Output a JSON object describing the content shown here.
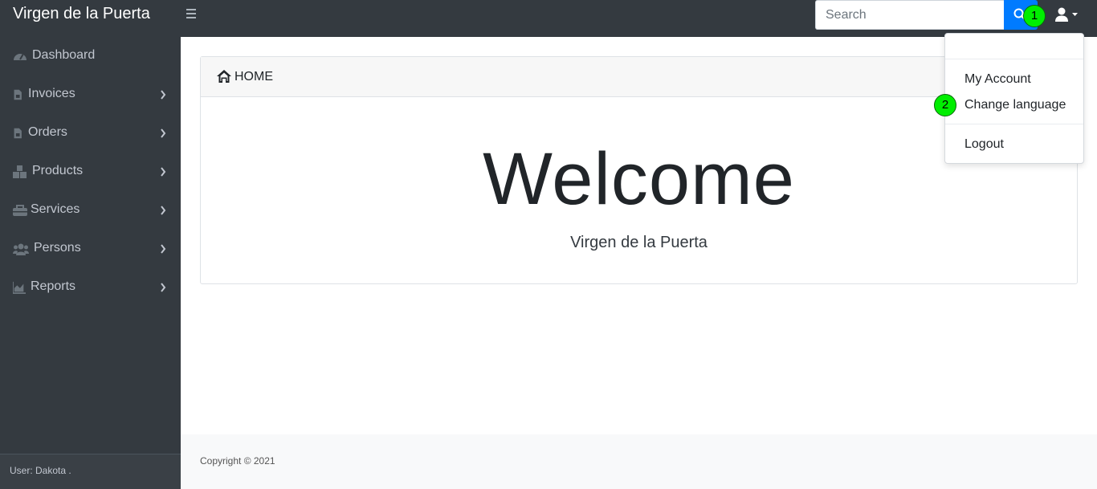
{
  "header": {
    "brand": "Virgen de la Puerta",
    "search_placeholder": "Search"
  },
  "sidebar": {
    "items": [
      {
        "label": "Dashboard",
        "icon": "dashboard-icon"
      },
      {
        "label": "Invoices",
        "icon": "file-invoice-icon"
      },
      {
        "label": "Orders",
        "icon": "file-invoice-icon"
      },
      {
        "label": "Products",
        "icon": "boxes-icon"
      },
      {
        "label": "Services",
        "icon": "toolbox-icon"
      },
      {
        "label": "Persons",
        "icon": "users-icon"
      },
      {
        "label": "Reports",
        "icon": "chart-area-icon"
      }
    ],
    "footer_user": "User: Dakota ."
  },
  "card": {
    "header_label": "HOME",
    "title": "Welcome",
    "subtitle": "Virgen de la Puerta"
  },
  "user_menu": {
    "items": [
      "My Account",
      "Change language",
      "Logout"
    ]
  },
  "markers": [
    "1",
    "2"
  ],
  "footer": {
    "copyright": "Copyright © 2021"
  },
  "colors": {
    "topbar": "#343a40",
    "sidebar": "#343a40",
    "primary": "#007bff",
    "marker": "#00ee00"
  }
}
